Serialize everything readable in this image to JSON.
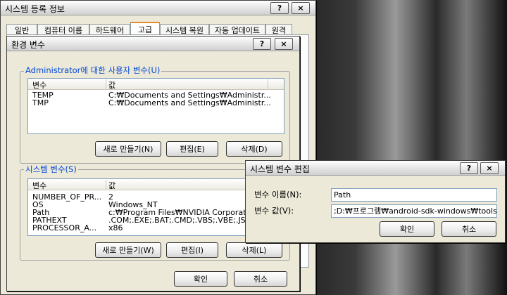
{
  "sysprops": {
    "title": "시스템 등록 정보",
    "help": "?",
    "close": "×",
    "tabs": [
      "일반",
      "컴퓨터 이름",
      "하드웨어",
      "고급",
      "시스템 복원",
      "자동 업데이트",
      "원격"
    ]
  },
  "envvars": {
    "title": "환경 변수",
    "help": "?",
    "close": "×",
    "user_group_label": "Administrator에 대한 사용자 변수(U)",
    "user_columns": [
      "변수",
      "값"
    ],
    "user_rows": [
      {
        "name": "TEMP",
        "value": "C:₩Documents and Settings₩Administr..."
      },
      {
        "name": "TMP",
        "value": "C:₩Documents and Settings₩Administr..."
      }
    ],
    "user_buttons": {
      "new": "새로 만들기(N)",
      "edit": "편집(E)",
      "delete": "삭제(D)"
    },
    "system_group_label": "시스템 변수(S)",
    "system_columns": [
      "변수",
      "값"
    ],
    "system_rows": [
      {
        "name": "NUMBER_OF_PR...",
        "value": "2"
      },
      {
        "name": "OS",
        "value": "Windows_NT"
      },
      {
        "name": "Path",
        "value": "c:₩Program Files₩NVIDIA Corporation..."
      },
      {
        "name": "PATHEXT",
        "value": ".COM;.EXE;.BAT;.CMD;.VBS;.VBE;.JS"
      },
      {
        "name": "PROCESSOR_A...",
        "value": "x86"
      }
    ],
    "system_buttons": {
      "new": "새로 만들기(W)",
      "edit": "편집(I)",
      "delete": "삭제(L)"
    },
    "ok": "확인",
    "cancel": "취소"
  },
  "editvar": {
    "title": "시스템 변수 편집",
    "help": "?",
    "close": "×",
    "name_label": "변수 이름(N):",
    "name_value": "Path",
    "value_label": "변수 값(V):",
    "value_value": ";D:₩프로그램₩android-sdk-windows₩tools",
    "ok": "확인",
    "cancel": "취소"
  }
}
